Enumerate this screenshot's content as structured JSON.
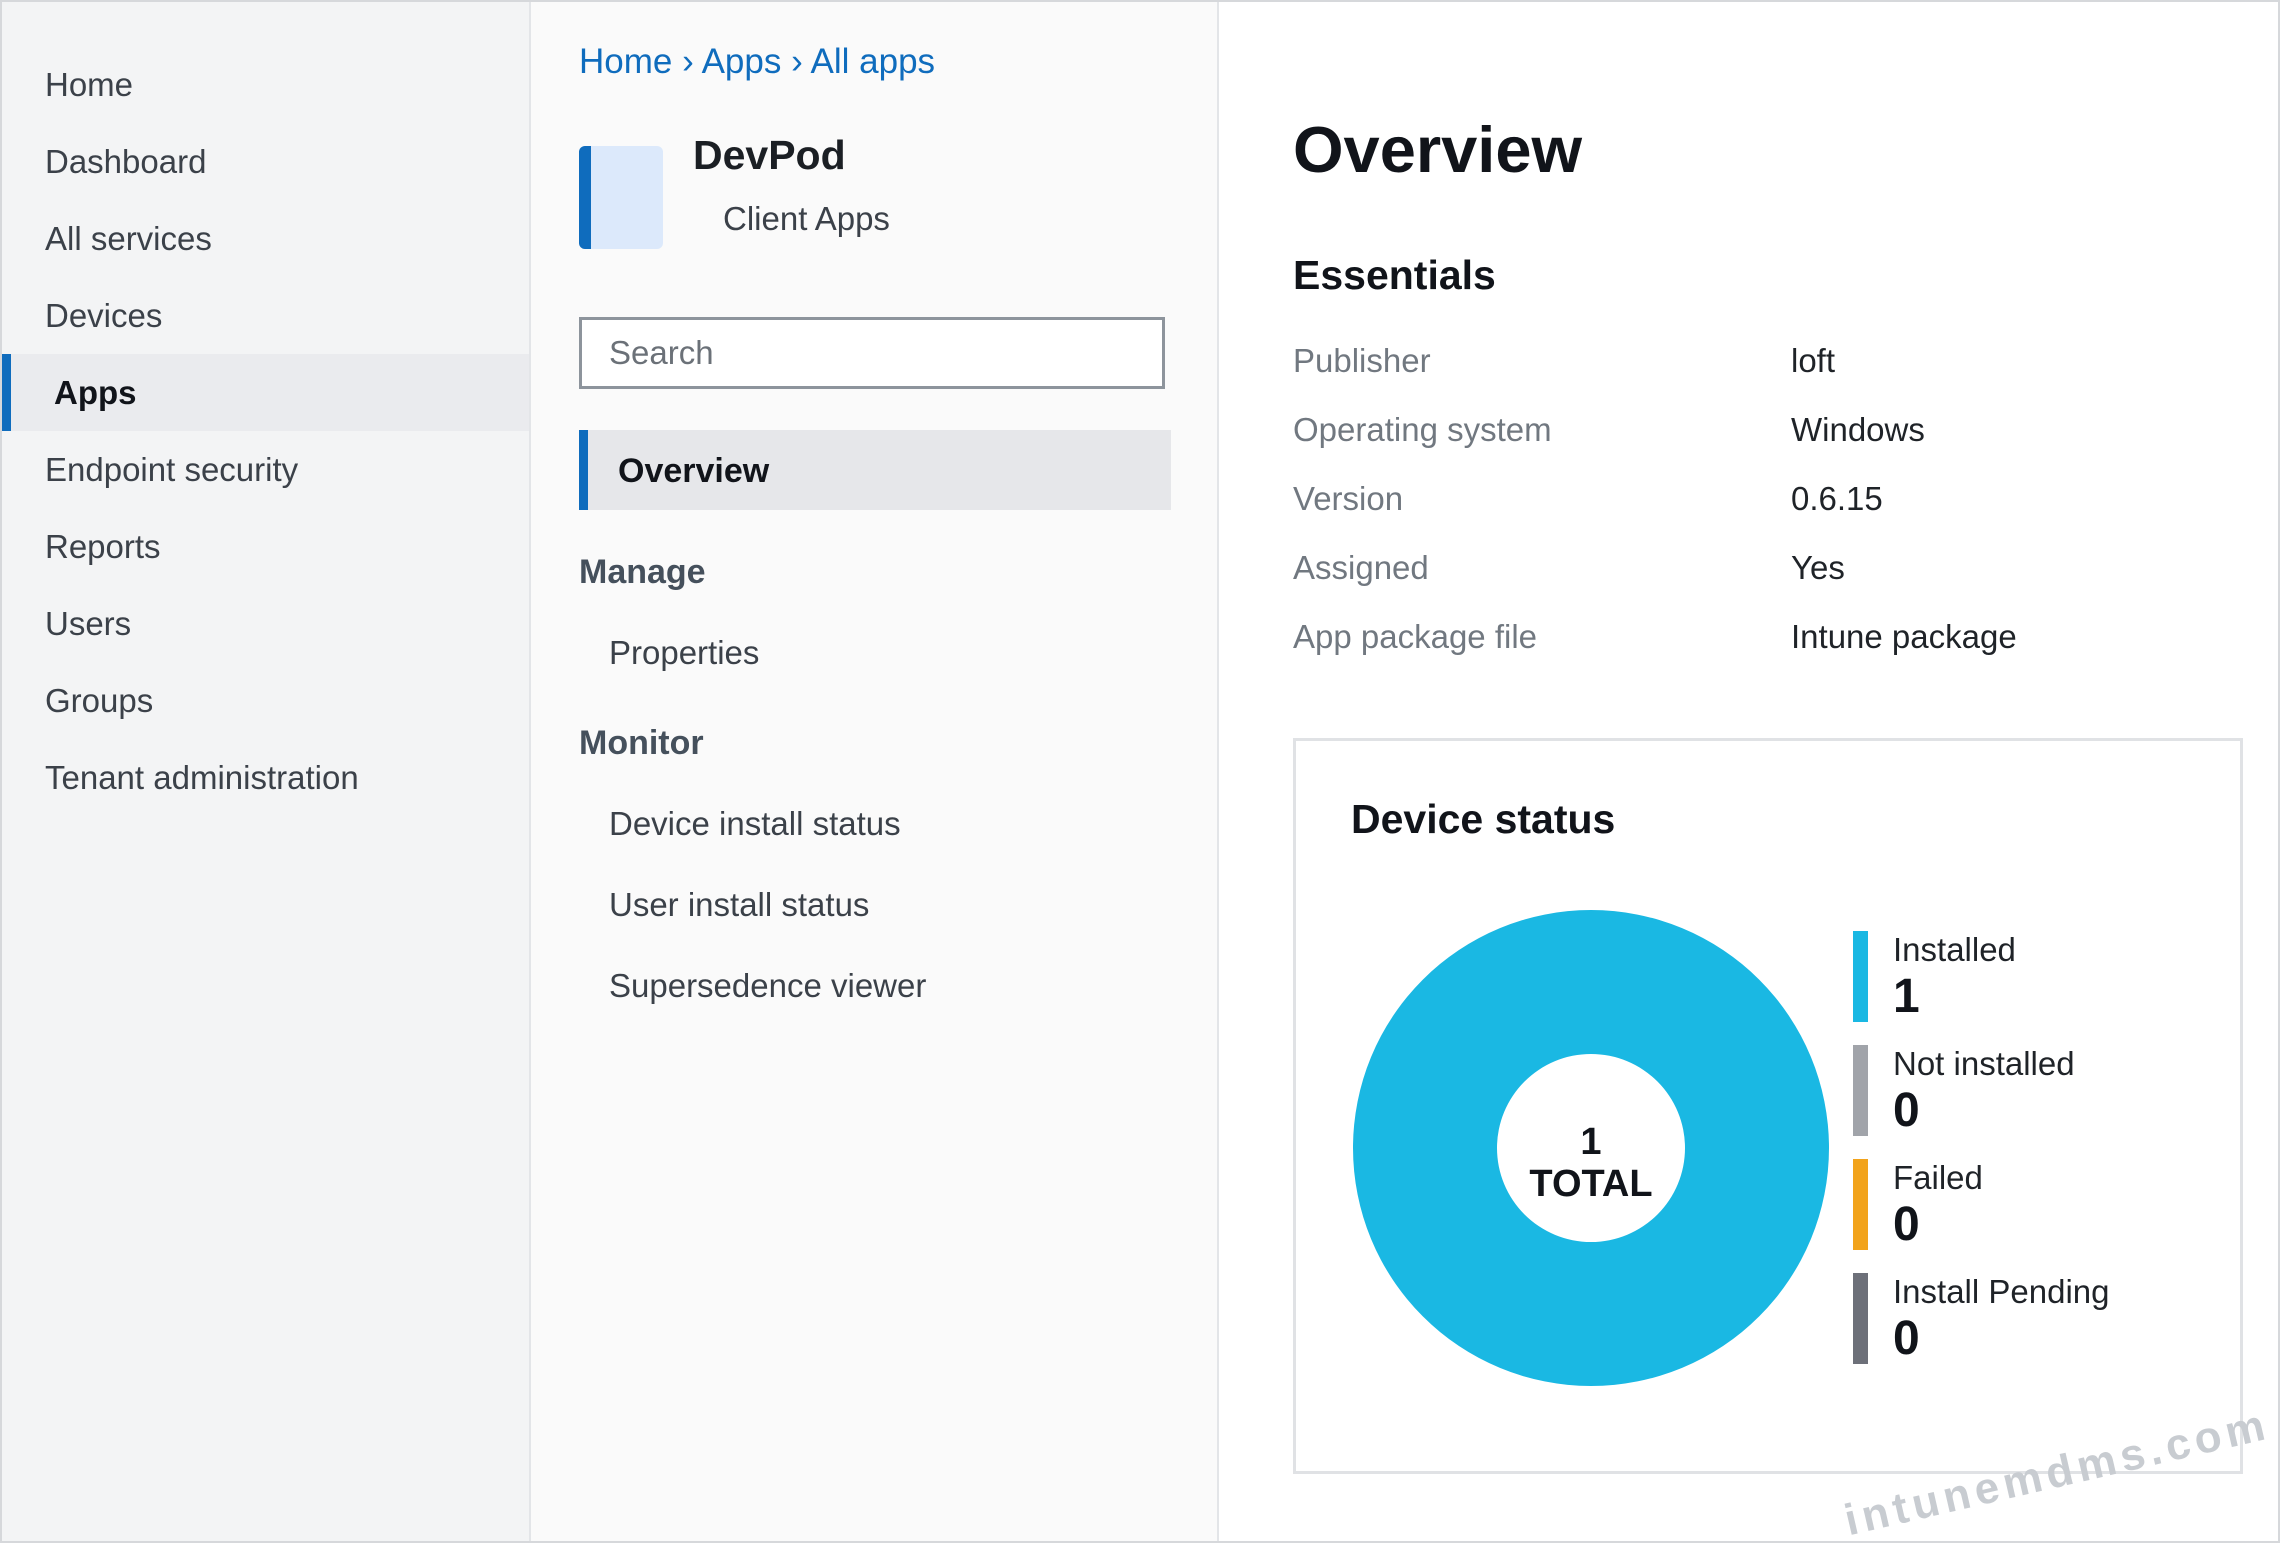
{
  "leftnav": {
    "items": [
      {
        "label": "Home"
      },
      {
        "label": "Dashboard"
      },
      {
        "label": "All services"
      },
      {
        "label": "Devices"
      },
      {
        "label": "Apps",
        "active": true
      },
      {
        "label": "Endpoint security"
      },
      {
        "label": "Reports"
      },
      {
        "label": "Users"
      },
      {
        "label": "Groups"
      },
      {
        "label": "Tenant administration"
      }
    ]
  },
  "breadcrumb": {
    "items": [
      "Home",
      "Apps",
      "All apps"
    ],
    "separator": "›"
  },
  "app": {
    "name": "DevPod",
    "subtitle": "Client Apps"
  },
  "search": {
    "placeholder": "Search",
    "value": ""
  },
  "menu": {
    "active_label": "Overview",
    "sections": [
      {
        "title": "Manage",
        "items": [
          "Properties"
        ]
      },
      {
        "title": "Monitor",
        "items": [
          "Device install status",
          "User install status",
          "Supersedence viewer"
        ]
      }
    ]
  },
  "overview": {
    "title": "Overview",
    "essentials_title": "Essentials",
    "essentials": [
      {
        "key": "Publisher",
        "value": "loft"
      },
      {
        "key": "Operating system",
        "value": "Windows"
      },
      {
        "key": "Version",
        "value": "0.6.15"
      },
      {
        "key": "Assigned",
        "value": "Yes"
      },
      {
        "key": "App package file",
        "value": "Intune package"
      }
    ]
  },
  "device_status": {
    "title": "Device status",
    "total_value": "1",
    "total_label": "TOTAL",
    "legend": [
      {
        "label": "Installed",
        "value": "1",
        "color": "#1ab8e3"
      },
      {
        "label": "Not installed",
        "value": "0",
        "color": "#a1a4aa"
      },
      {
        "label": "Failed",
        "value": "0",
        "color": "#f2a31b"
      },
      {
        "label": "Install Pending",
        "value": "0",
        "color": "#6d7079"
      }
    ]
  },
  "chart_data": {
    "type": "pie",
    "title": "Device status",
    "categories": [
      "Installed",
      "Not installed",
      "Failed",
      "Install Pending"
    ],
    "values": [
      1,
      0,
      0,
      0
    ],
    "colors": [
      "#1ab8e3",
      "#a1a4aa",
      "#f2a31b",
      "#6d7079"
    ],
    "donut": true,
    "legend": "right"
  },
  "watermark": "intunemdms.com"
}
